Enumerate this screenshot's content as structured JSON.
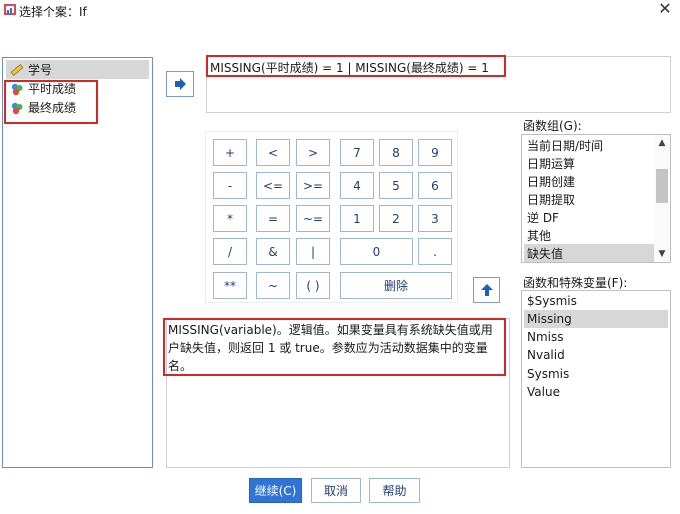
{
  "window": {
    "title": "选择个案：If",
    "close_glyph": "✕"
  },
  "variables": {
    "items": [
      {
        "label": "学号",
        "icon": "ruler-icon",
        "selected": true
      },
      {
        "label": "平时成绩",
        "icon": "nominal-variable-icon",
        "selected": false
      },
      {
        "label": "最终成绩",
        "icon": "nominal-variable-icon",
        "selected": false
      }
    ]
  },
  "expression": {
    "text": "MISSING(平时成绩) = 1 | MISSING(最终成绩) = 1"
  },
  "keypad": {
    "plus": "+",
    "lt": "<",
    "gt": ">",
    "k7": "7",
    "k8": "8",
    "k9": "9",
    "minus": "-",
    "le": "<=",
    "ge": ">=",
    "k4": "4",
    "k5": "5",
    "k6": "6",
    "mul": "*",
    "eq": "=",
    "ne": "~=",
    "k1": "1",
    "k2": "2",
    "k3": "3",
    "div": "/",
    "and": "&",
    "or": "|",
    "k0": "0",
    "dot": ".",
    "pow": "**",
    "not": "~",
    "parens": "( )",
    "delete": "删除"
  },
  "description": {
    "text": "MISSING(variable)。逻辑值。如果变量具有系统缺失值或用户缺失值，则返回 1 或 true。参数应为活动数据集中的变量名。"
  },
  "function_group": {
    "label": "函数组(G):",
    "items": [
      "当前日期/时间",
      "日期运算",
      "日期创建",
      "日期提取",
      "逆 DF",
      "其他",
      "缺失值"
    ],
    "selected": "缺失值"
  },
  "special_vars": {
    "label": "函数和特殊变量(F):",
    "items": [
      "$Sysmis",
      "Missing",
      "Nmiss",
      "Nvalid",
      "Sysmis",
      "Value"
    ],
    "selected": "Missing"
  },
  "buttons": {
    "continue": "继续(C)",
    "cancel": "取消",
    "help": "帮助"
  },
  "colors": {
    "accent": "#2f74d6",
    "highlight_box": "#d62728",
    "selection": "#d7d7d7"
  }
}
